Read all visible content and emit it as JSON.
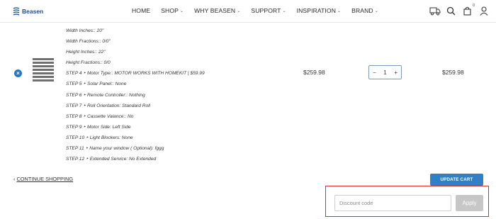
{
  "brand": {
    "name": "Beasen",
    "color": "#1d4e8f"
  },
  "nav": [
    {
      "label": "HOME",
      "dropdown": false
    },
    {
      "label": "SHOP",
      "dropdown": true
    },
    {
      "label": "WHY BEASEN",
      "dropdown": true
    },
    {
      "label": "SUPPORT",
      "dropdown": true
    },
    {
      "label": "INSPIRATION",
      "dropdown": true
    },
    {
      "label": "BRAND",
      "dropdown": true
    }
  ],
  "header_icons": [
    "truck-icon",
    "search-icon",
    "cart-icon",
    "user-icon"
  ],
  "cart_count": "0",
  "product": {
    "options": [
      "Width Inches:: 20\"",
      "Width Fractions:: 0/0\"",
      "Height Inches:: 22\"",
      "Height Fractions:: 0/0",
      "STEP 4 ‣ Motor Type:: MOTOR WORKS WITH HOMEKIT | $59.99",
      "STEP 5 ‣ Solar Panel:: None",
      "STEP 6 ‣ Remote Controller:: Nothing",
      "STEP 7 ‣ Roll Orientation: Standard Roll",
      "STEP 8 ‣ Cassette Valance:: No",
      "STEP 9 ‣ Motor Side: Left Side",
      "STEP 10 ‣ Light Blockers: None",
      "STEP 11 ‣ Name your window ( Optional): fggg",
      "STEP 12 ‣ Extended Service: No Extended"
    ],
    "price": "$259.98",
    "quantity": "1",
    "minus": "−",
    "plus": "+",
    "subtotal": "$259.98",
    "remove_label": "×"
  },
  "actions": {
    "continue_arrow": "‹",
    "continue_label": "CONTINUE SHOPPING",
    "update_label": "UPDATE CART"
  },
  "discount": {
    "placeholder": "Discount code",
    "value": "",
    "apply_label": "Apply"
  }
}
